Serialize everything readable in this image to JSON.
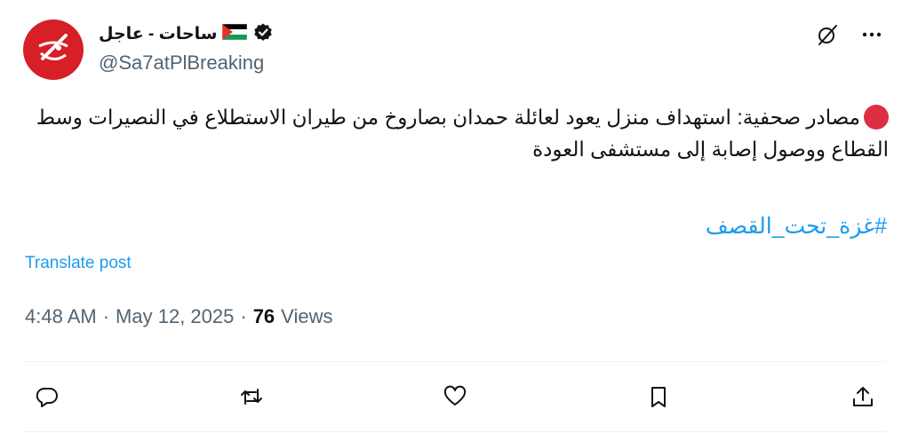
{
  "author": {
    "display_name": "ساحات - عاجل",
    "handle": "@Sa7atPlBreaking",
    "verified": true,
    "flag": "palestine-flag-emoji"
  },
  "tweet": {
    "text": "مصادر صحفية: استهداف منزل يعود لعائلة حمدان بصاروخ من طيران الاستطلاع في النصيرات وسط القطاع ووصول إصابة إلى مستشفى العودة",
    "hashtag": "#غزة_تحت_القصف"
  },
  "translate_label": "Translate post",
  "meta": {
    "time": "4:48 AM",
    "separator": "·",
    "date": "May 12, 2025",
    "views_count": "76",
    "views_label": "Views"
  },
  "colors": {
    "link": "#1d9bf0",
    "avatar_bg": "#d61f26",
    "dot": "#dd2e44",
    "text_secondary": "#536471"
  },
  "icons": [
    "grok-icon",
    "more-icon",
    "reply-icon",
    "repost-icon",
    "like-icon",
    "bookmark-icon",
    "share-icon",
    "verified-badge-icon"
  ]
}
